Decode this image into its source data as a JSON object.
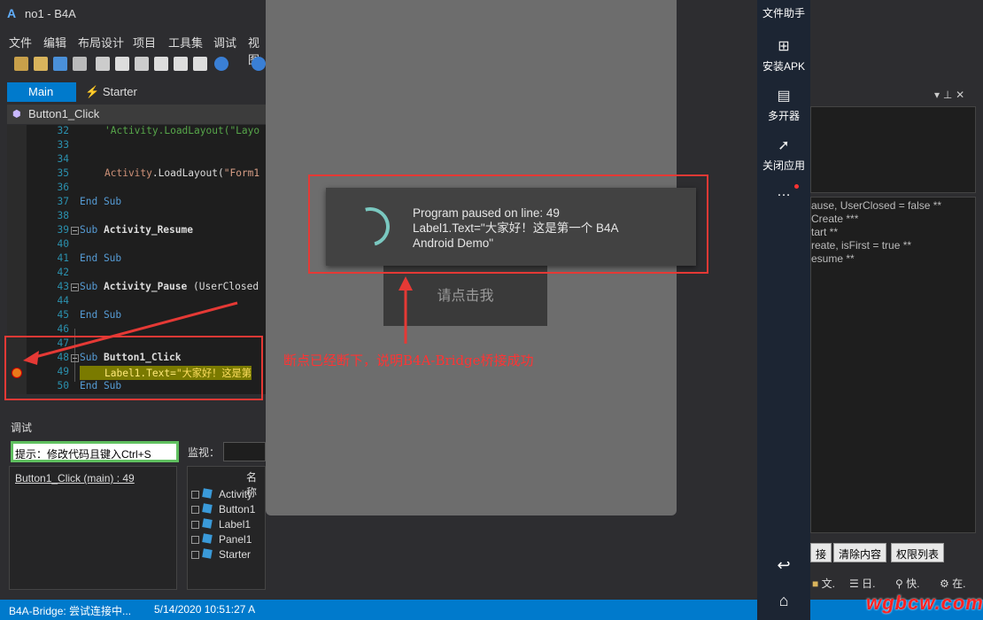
{
  "window": {
    "title": "no1 - B4A"
  },
  "menu": [
    "文件",
    "编辑",
    "布局设计",
    "项目",
    "工具集",
    "调试",
    "视图"
  ],
  "tabs": [
    {
      "label": "Main"
    },
    {
      "label": "Starter"
    }
  ],
  "sub_header": "Button1_Click",
  "editor": {
    "lines": [
      {
        "num": "32",
        "code": "'Activity.LoadLayout(\"Layo"
      },
      {
        "num": "33",
        "code": ""
      },
      {
        "num": "34",
        "code": ""
      },
      {
        "num": "35",
        "code_kw": "Activity",
        "code_rest": ".LoadLayout(",
        "code_str": "\"Form1"
      },
      {
        "num": "36",
        "code": ""
      },
      {
        "num": "37",
        "code": "End Sub"
      },
      {
        "num": "38",
        "code": ""
      },
      {
        "num": "39",
        "code_kw": "Sub ",
        "code_bold": "Activity_Resume"
      },
      {
        "num": "40",
        "code": ""
      },
      {
        "num": "41",
        "code": "End Sub"
      },
      {
        "num": "42",
        "code": ""
      },
      {
        "num": "43",
        "code_kw": "Sub ",
        "code_bold": "Activity_Pause",
        "code_rest": " (UserClosed"
      },
      {
        "num": "44",
        "code": ""
      },
      {
        "num": "45",
        "code": "End Sub"
      },
      {
        "num": "46",
        "code": ""
      },
      {
        "num": "47",
        "code": ""
      },
      {
        "num": "48",
        "code_kw": "Sub ",
        "code_bold": "Button1_Click"
      },
      {
        "num": "49",
        "code_rest": "Label1.Text=",
        "code_str": "\"大家好！这是第"
      },
      {
        "num": "50",
        "code": "End Sub"
      }
    ]
  },
  "debug": {
    "title": "调试",
    "hint": "提示：修改代码且键入Ctrl+S",
    "watch_label": "监视：",
    "stack_entry": "Button1_Click (main) : 49",
    "tree_header": "名称",
    "tree_items": [
      "Activity",
      "Button1",
      "Label1",
      "Panel1",
      "Starter"
    ]
  },
  "status": {
    "left": "B4A-Bridge: 尝试连接中...",
    "time": "5/14/2020 10:51:27 A"
  },
  "emulator": {
    "button_label": "请点击我",
    "dialog_text": "Program paused on line: 49\nLabel1.Text=\"大家好！这是第一个 B4A\nAndroid Demo\""
  },
  "annotation": "断点已经断下，说明B4A-Bridge桥接成功",
  "sidebar": [
    {
      "label": "文件助手",
      "icon": "file-helper-icon"
    },
    {
      "label": "安装APK",
      "icon": "install-apk-icon"
    },
    {
      "label": "多开器",
      "icon": "multi-open-icon"
    },
    {
      "label": "关闭应用",
      "icon": "rocket-icon"
    },
    {
      "label": "…",
      "icon": "more-icon"
    }
  ],
  "right_panel": {
    "logs": [
      "ause, UserClosed = false **",
      "Create ***",
      "tart **",
      "reate, isFirst = true **",
      "esume **"
    ],
    "buttons": [
      "接",
      "清除内容",
      "权限列表"
    ],
    "tabs": [
      "文.",
      "日.",
      "快.",
      "在."
    ]
  },
  "watermark": "wgbcw.com",
  "colors": {
    "accent": "#007acc",
    "annotation_red": "#e53935",
    "hint_border": "#5fbf5f"
  }
}
